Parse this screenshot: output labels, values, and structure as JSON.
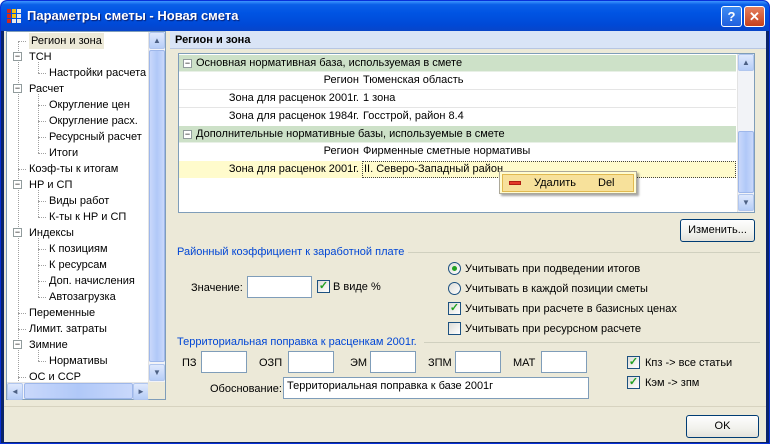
{
  "window": {
    "title": "Параметры сметы - Новая смета",
    "help_label": "?",
    "close_label": "✕"
  },
  "tree": {
    "items": [
      {
        "label": "Регион и зона",
        "level": 0,
        "expander": "",
        "selected": true
      },
      {
        "label": "ТСН",
        "level": 0,
        "expander": "−"
      },
      {
        "label": "Настройки расчета",
        "level": 1,
        "expander": ""
      },
      {
        "label": "Расчет",
        "level": 0,
        "expander": "−"
      },
      {
        "label": "Округление цен",
        "level": 1,
        "expander": ""
      },
      {
        "label": "Округление расх.",
        "level": 1,
        "expander": ""
      },
      {
        "label": "Ресурсный расчет",
        "level": 1,
        "expander": ""
      },
      {
        "label": "Итоги",
        "level": 1,
        "expander": ""
      },
      {
        "label": "Коэф-ты к итогам",
        "level": 0,
        "expander": ""
      },
      {
        "label": "НР и СП",
        "level": 0,
        "expander": "−"
      },
      {
        "label": "Виды работ",
        "level": 1,
        "expander": ""
      },
      {
        "label": "К-ты к НР и СП",
        "level": 1,
        "expander": ""
      },
      {
        "label": "Индексы",
        "level": 0,
        "expander": "−"
      },
      {
        "label": "К позициям",
        "level": 1,
        "expander": ""
      },
      {
        "label": "К ресурсам",
        "level": 1,
        "expander": ""
      },
      {
        "label": "Доп. начисления",
        "level": 1,
        "expander": ""
      },
      {
        "label": "Автозагрузка",
        "level": 1,
        "expander": ""
      },
      {
        "label": "Переменные",
        "level": 0,
        "expander": ""
      },
      {
        "label": "Лимит. затраты",
        "level": 0,
        "expander": ""
      },
      {
        "label": "Зимние",
        "level": 0,
        "expander": "−"
      },
      {
        "label": "Нормативы",
        "level": 1,
        "expander": ""
      },
      {
        "label": "ОС и ССР",
        "level": 0,
        "expander": ""
      }
    ],
    "scroll_up": "▲",
    "scroll_down": "▼",
    "scroll_left": "◄",
    "scroll_right": "►"
  },
  "panel": {
    "header": "Регион и зона",
    "grid": {
      "expander": "−",
      "section1_title": "Основная нормативная база, используемая в смете",
      "row1_label": "Регион",
      "row1_value": "Тюменская область",
      "row2_label": "Зона для расценок 2001г.",
      "row2_value": "1 зона",
      "row3_label": "Зона для расценок 1984г.",
      "row3_value": "Госстрой, район 8.4",
      "section2_title": "Дополнительные нормативные базы, используемые в смете",
      "row4_label": "Регион",
      "row4_value": "Фирменные сметные нормативы",
      "row5_label": "Зона для расценок 2001г.",
      "row5_value": "II. Северо-Западный район",
      "scroll_up": "▲",
      "scroll_down": "▼"
    },
    "context_menu": {
      "label": "Удалить",
      "shortcut": "Del"
    },
    "change_button": "Изменить...",
    "wage": {
      "title": "Районный коэффициент к заработной плате",
      "value_label": "Значение:",
      "value": "",
      "percent_label": "В виде %",
      "percent_checked": true,
      "radio1": "Учитывать при подведении итогов",
      "radio1_selected": true,
      "radio2": "Учитывать в каждой позиции сметы",
      "check_base": "Учитывать при расчете в базисных ценах",
      "check_base_checked": true,
      "check_resource": "Учитывать при ресурсном расчете",
      "check_resource_checked": false
    },
    "territorial": {
      "title": "Территориальная поправка к расценкам 2001г.",
      "pz_label": "ПЗ",
      "ozp_label": "ОЗП",
      "em_label": "ЭМ",
      "zpm_label": "ЗПМ",
      "mat_label": "МАТ",
      "pz": "",
      "ozp": "",
      "em": "",
      "zpm": "",
      "mat": "",
      "check_kpz": "Кпз -> все статьи",
      "check_kem": "Кэм -> зпм",
      "basis_label": "Обоснование:",
      "basis_value": "Территориальная поправка к базе 2001г"
    }
  },
  "footer": {
    "ok_label": "OK"
  },
  "colors": {
    "accent": "#0046d5",
    "category_bg": "#cde1c8",
    "highlight_bg": "#fffbcc",
    "titlebar": "#0054e3"
  }
}
